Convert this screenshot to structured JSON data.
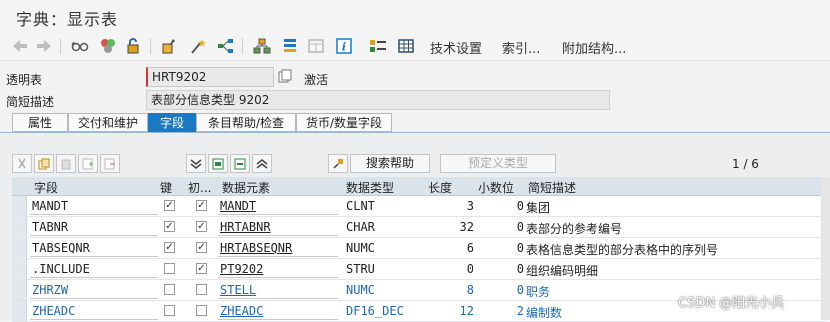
{
  "window": {
    "title": "字典：显示表"
  },
  "toolbar": {
    "icons": [
      "back-arrow-icon",
      "forward-arrow-icon",
      "glasses-icon",
      "other-object-icon",
      "edit-toggle-icon",
      "check-icon",
      "activate-icon",
      "where-used-icon",
      "navigation-icon",
      "hierarchy-icon",
      "display-list-icon",
      "info-icon",
      "object-list-icon",
      "table-icon"
    ],
    "tech_settings": "技术设置",
    "index": "索引...",
    "append_structure": "附加结构..."
  },
  "header": {
    "table_label": "透明表",
    "table_value": "HRT9202",
    "status": "激活",
    "desc_label": "简短描述",
    "desc_value": "表部分信息类型 9202"
  },
  "tabs": [
    {
      "label": "属性",
      "active": false
    },
    {
      "label": "交付和维护",
      "active": false
    },
    {
      "label": "字段",
      "active": true
    },
    {
      "label": "条目帮助/检查",
      "active": false
    },
    {
      "label": "货币/数量字段",
      "active": false
    }
  ],
  "table_toolbar": {
    "search_help": "搜索帮助",
    "predefined_type": "预定义类型",
    "pager": "1 / 6"
  },
  "table": {
    "columns": [
      "字段",
      "键",
      "初...",
      "数据元素",
      "数据类型",
      "长度",
      "小数位",
      "简短描述"
    ],
    "rows": [
      {
        "field": "MANDT",
        "key": true,
        "init": true,
        "element": "MANDT",
        "type": "CLNT",
        "length": "3",
        "decimals": "0",
        "desc": "集团",
        "blue": false
      },
      {
        "field": "TABNR",
        "key": true,
        "init": true,
        "element": "HRTABNR",
        "type": "CHAR",
        "length": "32",
        "decimals": "0",
        "desc": "表部分的参考编号",
        "blue": false
      },
      {
        "field": "TABSEQNR",
        "key": true,
        "init": true,
        "element": "HRTABSEQNR",
        "type": "NUMC",
        "length": "6",
        "decimals": "0",
        "desc": "表格信息类型的部分表格中的序列号",
        "blue": false
      },
      {
        "field": ".INCLUDE",
        "key": false,
        "init": true,
        "element": "PT9202",
        "type": "STRU",
        "length": "0",
        "decimals": "0",
        "desc": "组织编码明细",
        "blue": false
      },
      {
        "field": "ZHRZW",
        "key": false,
        "init": false,
        "element": "STELL",
        "type": "NUMC",
        "length": "8",
        "decimals": "0",
        "desc": "职务",
        "blue": true
      },
      {
        "field": "ZHEADC",
        "key": false,
        "init": false,
        "element": "ZHEADC",
        "type": "DF16_DEC",
        "length": "12",
        "decimals": "2",
        "desc": "编制数",
        "blue": true
      }
    ]
  },
  "watermark": "CSDN @阳光小兵"
}
